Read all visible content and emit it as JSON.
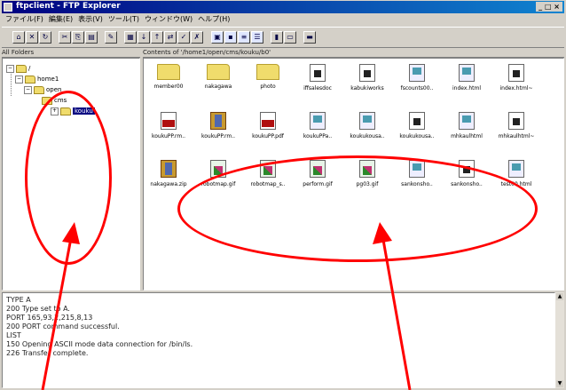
{
  "window": {
    "title": "ftpclient - FTP Explorer",
    "controls": "_ □ ×"
  },
  "menu": [
    "ファイル(F)",
    "編集(E)",
    "表示(V)",
    "ツール(T)",
    "ウィンドウ(W)",
    "ヘルプ(H)"
  ],
  "panes": {
    "tree_header": "All Folders",
    "files_header": "Contents of '/home1/open/cms/kouku/b0'"
  },
  "tree": [
    {
      "label": "/",
      "level": 0
    },
    {
      "label": "home1",
      "level": 1
    },
    {
      "label": "open",
      "level": 2
    },
    {
      "label": "cms",
      "level": 3
    },
    {
      "label": "kouku",
      "level": 4,
      "selected": true
    }
  ],
  "files": [
    {
      "name": "member00",
      "type": "folder"
    },
    {
      "name": "nakagawa",
      "type": "folder"
    },
    {
      "name": "photo",
      "type": "folder"
    },
    {
      "name": "iffsalesdoc",
      "type": "doc"
    },
    {
      "name": "kabukiworks",
      "type": "doc"
    },
    {
      "name": "fscounts00..",
      "type": "html"
    },
    {
      "name": "index.html",
      "type": "html"
    },
    {
      "name": "index.html~",
      "type": "doc"
    },
    {
      "name": "koukuPP.rm..",
      "type": "pdf"
    },
    {
      "name": "koukuPP.rm..",
      "type": "pkg"
    },
    {
      "name": "koukuPP.pdf",
      "type": "pdf"
    },
    {
      "name": "koukuPPa..",
      "type": "html"
    },
    {
      "name": "koukukousa..",
      "type": "html"
    },
    {
      "name": "koukukousa..",
      "type": "doc"
    },
    {
      "name": "mhkaulhtml",
      "type": "html"
    },
    {
      "name": "mhkaulhtml~",
      "type": "doc"
    },
    {
      "name": "nakagawa.zip",
      "type": "pkg"
    },
    {
      "name": "robotmap.gif",
      "type": "img"
    },
    {
      "name": "robotmap_s..",
      "type": "img"
    },
    {
      "name": "perform.gif",
      "type": "img"
    },
    {
      "name": "pg03.gif",
      "type": "img"
    },
    {
      "name": "sankonsho..",
      "type": "html"
    },
    {
      "name": "sankonsho..",
      "type": "doc"
    },
    {
      "name": "test00.html",
      "type": "html"
    }
  ],
  "log": [
    "TYPE A",
    "200 Type set to A.",
    "PORT 165,93,2,215,8,13",
    "200 PORT command successful.",
    "LIST",
    "150 Opening ASCII mode data connection for /bin/ls.",
    "226 Transfer complete."
  ],
  "annotation_color": "#ff0000"
}
